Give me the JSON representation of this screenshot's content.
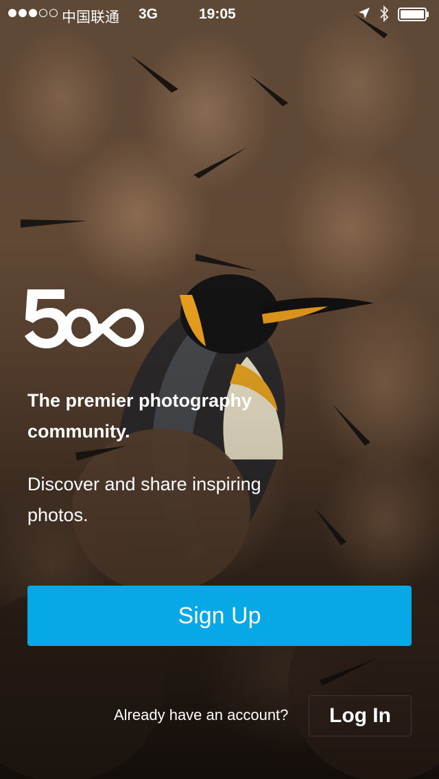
{
  "status_bar": {
    "signal_filled": 3,
    "signal_total": 5,
    "carrier": "中国联通",
    "network": "3G",
    "time": "19:05",
    "icons": [
      "location-arrow-icon",
      "bluetooth-icon",
      "battery-icon"
    ]
  },
  "brand": {
    "logo_icon": "500px-logo-icon"
  },
  "hero": {
    "headline": "The premier photography community.",
    "subline": "Discover and share inspiring photos."
  },
  "actions": {
    "signup_label": "Sign Up",
    "account_prompt": "Already have an account?",
    "login_label": "Log In"
  },
  "colors": {
    "signup_button": "#06a8e6",
    "text": "#ffffff"
  }
}
